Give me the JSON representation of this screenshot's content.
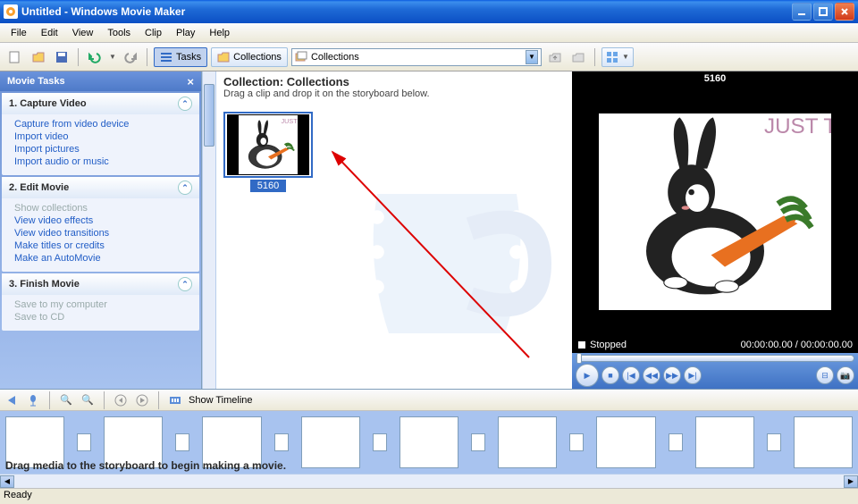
{
  "window": {
    "title": "Untitled - Windows Movie Maker"
  },
  "menu": {
    "file": "File",
    "edit": "Edit",
    "view": "View",
    "tools": "Tools",
    "clip": "Clip",
    "play": "Play",
    "help": "Help"
  },
  "toolbar": {
    "tasks": "Tasks",
    "collections": "Collections",
    "combo_value": "Collections"
  },
  "tasks": {
    "header": "Movie Tasks",
    "s1": {
      "title": "1. Capture Video",
      "links": [
        "Capture from video device",
        "Import video",
        "Import pictures",
        "Import audio or music"
      ]
    },
    "s2": {
      "title": "2. Edit Movie",
      "link0": "Show collections",
      "links": [
        "View video effects",
        "View video transitions",
        "Make titles or credits",
        "Make an AutoMovie"
      ]
    },
    "s3": {
      "title": "3. Finish Movie",
      "links": [
        "Save to my computer",
        "Save to CD"
      ]
    }
  },
  "collection": {
    "title": "Collection: Collections",
    "subtitle": "Drag a clip and drop it on the storyboard below.",
    "clip_name": "5160",
    "thumb_caption": "JUST TO SAY"
  },
  "preview": {
    "title": "5160",
    "caption": "JUST TO SAY",
    "status": "Stopped",
    "time": "00:00:00.00 / 00:00:00.00"
  },
  "timeline": {
    "toggle": "Show Timeline",
    "hint": "Drag media to the storyboard to begin making a movie."
  },
  "status": "Ready"
}
